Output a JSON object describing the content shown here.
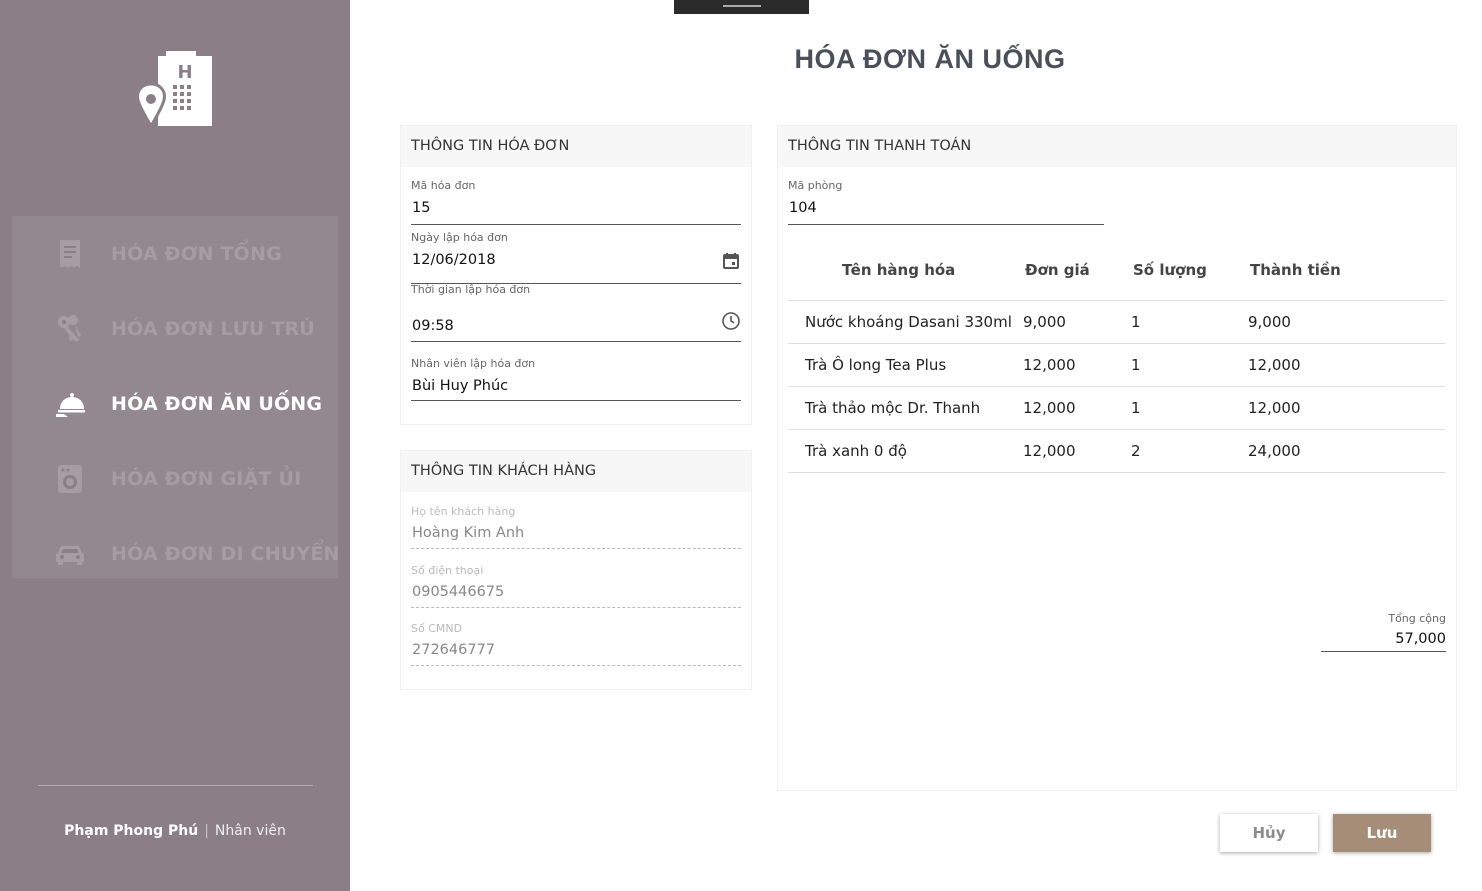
{
  "window": {
    "title": "HÓA ĐƠN ĂN UỐNG"
  },
  "sidebar": {
    "logo_letter": "H",
    "items": [
      {
        "label": "HÓA ĐƠN TỔNG",
        "icon": "receipt-icon",
        "active": false
      },
      {
        "label": "HÓA ĐƠN LƯU TRÚ",
        "icon": "keys-icon",
        "active": false
      },
      {
        "label": "HÓA ĐƠN ĂN UỐNG",
        "icon": "room-service-icon",
        "active": true
      },
      {
        "label": "HÓA ĐƠN GIẶT ỦI",
        "icon": "washing-machine-icon",
        "active": false
      },
      {
        "label": "HÓA ĐƠN DI CHUYỂN",
        "icon": "car-icon",
        "active": false
      }
    ],
    "user": {
      "name": "Phạm Phong Phú",
      "separator": "|",
      "role": "Nhân viên"
    }
  },
  "invoice_info": {
    "header": "THÔNG TIN HÓA ĐƠN",
    "invoice_id": {
      "label": "Mã hóa đơn",
      "value": "15"
    },
    "date": {
      "label": "Ngày lập hóa đơn",
      "value": "12/06/2018"
    },
    "time": {
      "label": "Thời gian lập hóa đơn",
      "value": "09:58"
    },
    "staff": {
      "label": "Nhân viên lập hóa đơn",
      "value": "Bùi Huy Phúc"
    }
  },
  "customer_info": {
    "header": "THÔNG TIN KHÁCH HÀNG",
    "name": {
      "label": "Họ tên khách hàng",
      "value": "Hoàng Kim Anh"
    },
    "phone": {
      "label": "Số điện thoại",
      "value": "0905446675"
    },
    "id_card": {
      "label": "Số CMND",
      "value": "272646777"
    }
  },
  "payment_info": {
    "header": "THÔNG TIN THANH TOÁN",
    "room": {
      "label": "Mã phòng",
      "value": "104"
    },
    "columns": [
      "Tên hàng hóa",
      "Đơn giá",
      "Số lượng",
      "Thành tiền"
    ],
    "rows": [
      [
        "Nước khoáng Dasani 330ml",
        "9,000",
        "1",
        "9,000"
      ],
      [
        "Trà Ô long Tea Plus",
        "12,000",
        "1",
        "12,000"
      ],
      [
        "Trà thảo mộc Dr. Thanh",
        "12,000",
        "1",
        "12,000"
      ],
      [
        "Trà xanh 0 độ",
        "12,000",
        "2",
        "24,000"
      ]
    ],
    "total": {
      "label": "Tổng cộng",
      "value": "57,000"
    }
  },
  "actions": {
    "cancel": "Hủy",
    "save": "Lưu"
  },
  "colors": {
    "sidebar": "#8b7f85",
    "accent": "#a58d77",
    "title": "#4a4f59"
  }
}
